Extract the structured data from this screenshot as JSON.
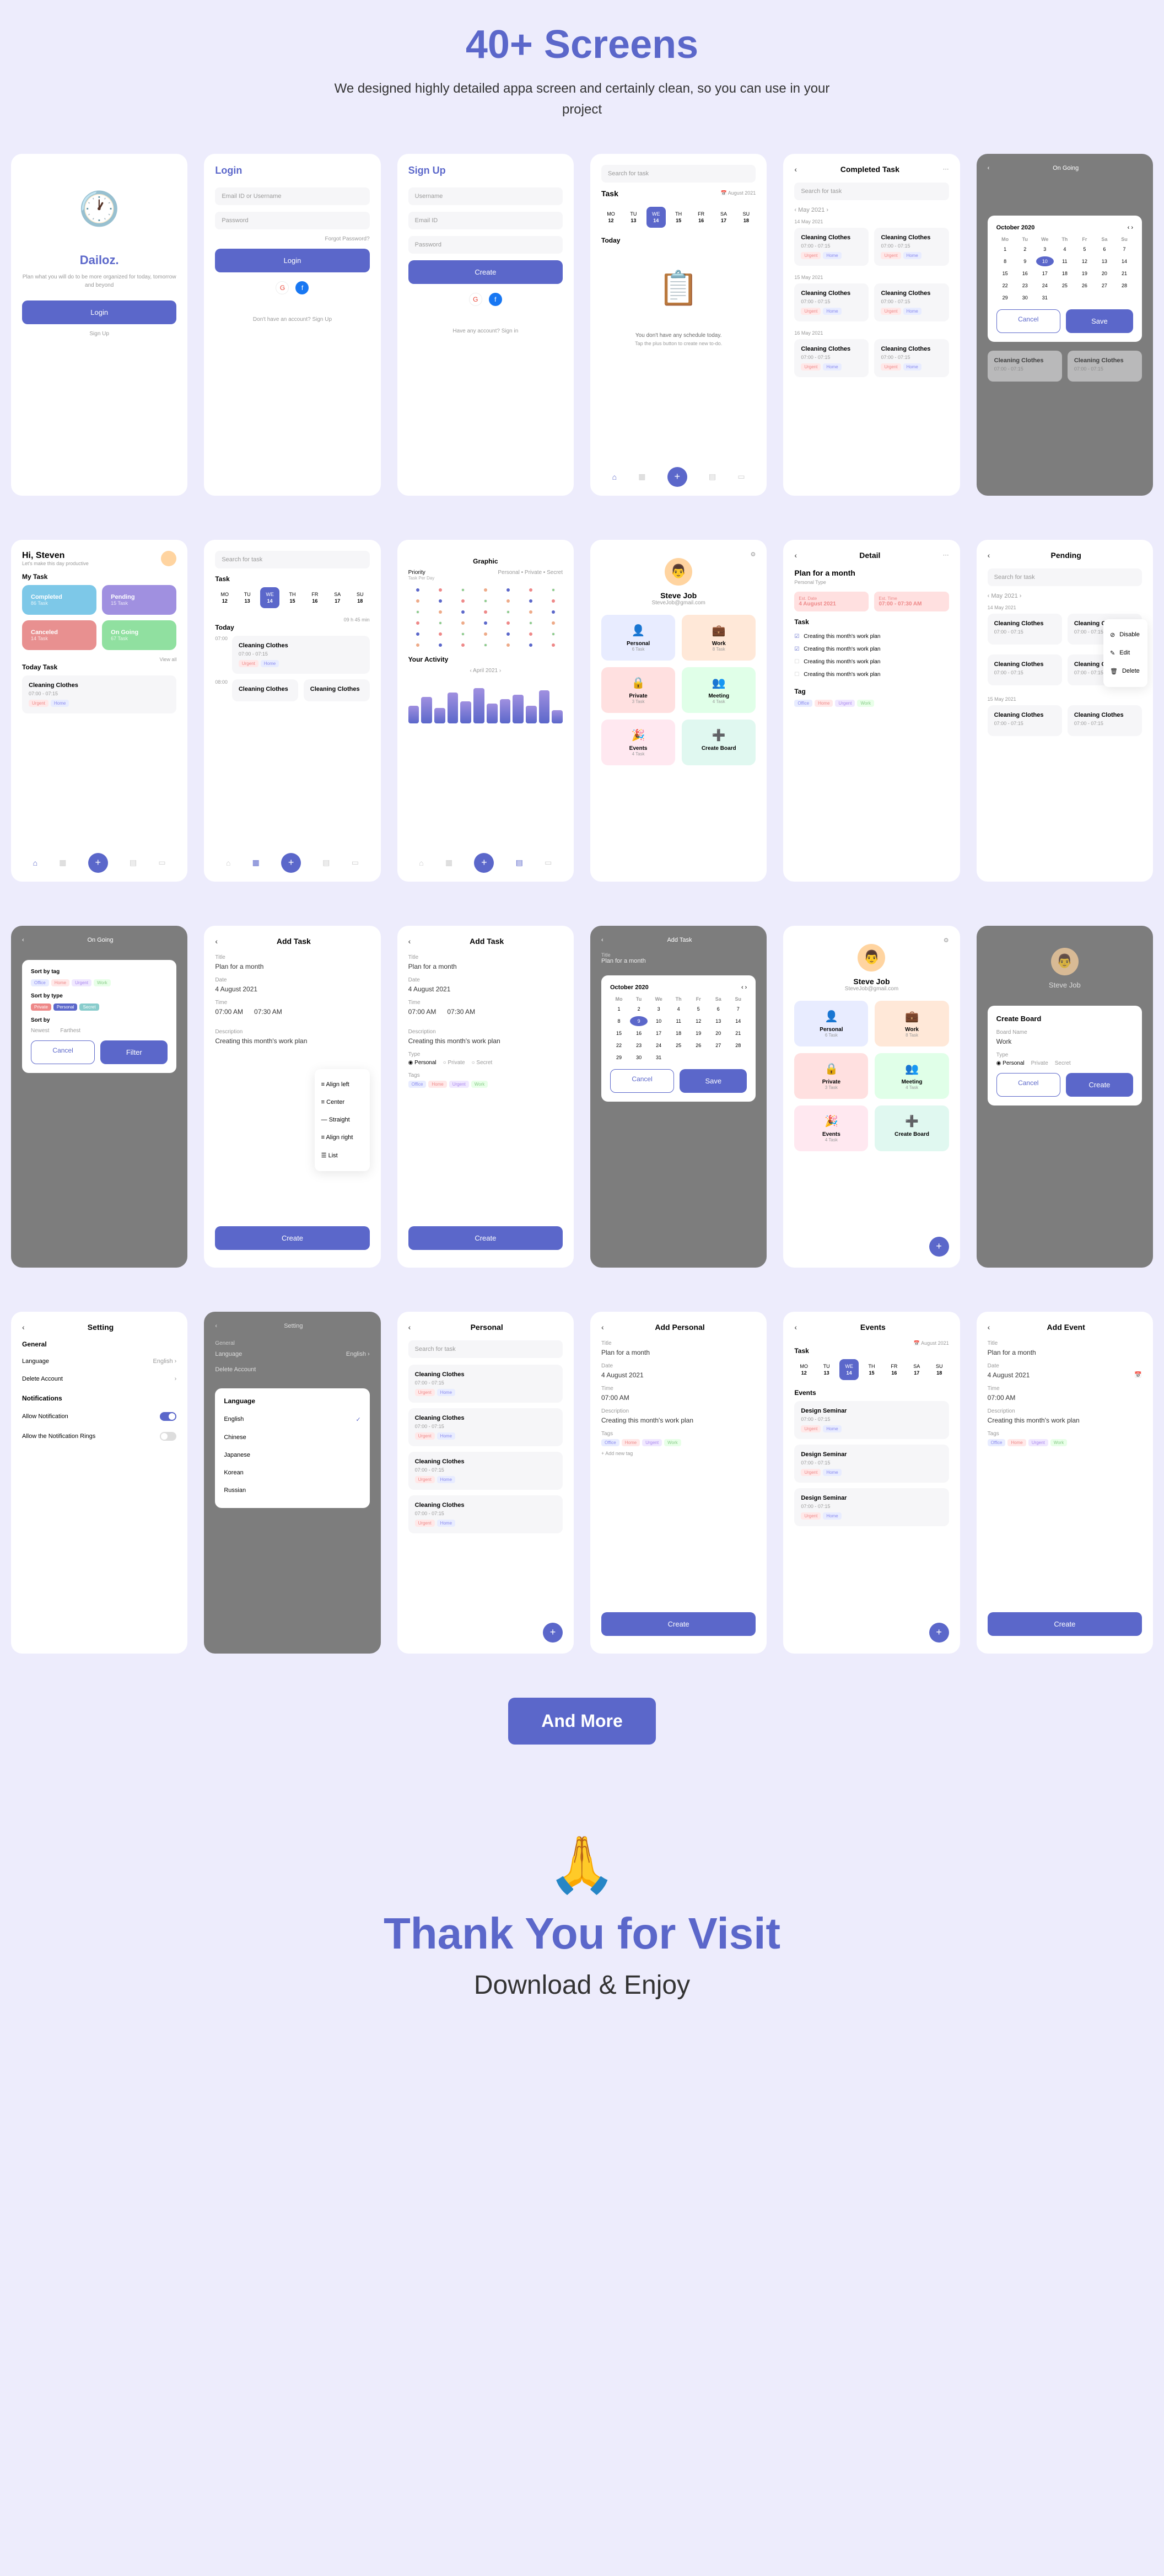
{
  "hero": {
    "title": "40+ Screens",
    "subtitle": "We designed highly detailed appa screen and certainly clean, so you can use in your project"
  },
  "cta": {
    "label": "And More"
  },
  "thanks": {
    "emoji": "🙏",
    "title": "Thank You for Visit",
    "subtitle": "Download & Enjoy"
  },
  "common": {
    "login": "Login",
    "signup": "Sign Up",
    "create": "Create",
    "cancel": "Cancel",
    "save": "Save",
    "filter": "Filter",
    "back": "‹",
    "dots": "⋯",
    "search": "Search for task",
    "forgot": "Forgot Password?",
    "noaccount": "Don't have an account? Sign Up",
    "hasaccount": "Have any account? Sign in",
    "task": "Task",
    "today": "Today",
    "date_aug": "📅 August 2021"
  },
  "welcome": {
    "app": "Dailoz.",
    "tagline": "Plan what you will do to be more organized for today, tomorrow and beyond",
    "signup": "Sign Up"
  },
  "login_fields": {
    "email": "Email ID or Username",
    "password": "Password"
  },
  "signup_fields": {
    "username": "Username",
    "email": "Email ID",
    "password": "Password"
  },
  "days": [
    {
      "d": "MO",
      "n": "12"
    },
    {
      "d": "TU",
      "n": "13"
    },
    {
      "d": "WE",
      "n": "14"
    },
    {
      "d": "TH",
      "n": "15"
    },
    {
      "d": "FR",
      "n": "16"
    },
    {
      "d": "SA",
      "n": "17"
    },
    {
      "d": "SU",
      "n": "18"
    }
  ],
  "empty": {
    "msg": "You don't have any schedule today.",
    "hint": "Tap the plus button to create new to-do."
  },
  "completed": {
    "title": "Completed Task",
    "month": "May 2021",
    "dates": [
      "14 May 2021",
      "15 May 2021",
      "16 May 2021"
    ]
  },
  "card": {
    "title": "Cleaning Clothes",
    "time": "07:00 - 07:15",
    "tags": [
      "Urgent",
      "Home"
    ]
  },
  "ongoing": {
    "title": "On Going",
    "cal_month": "October 2020"
  },
  "home": {
    "greeting": "Hi, Steven",
    "sub": "Let's make this day productive",
    "mytask": "My Task",
    "todaytask": "Today Task",
    "viewall": "View all",
    "stats": [
      {
        "t": "Completed",
        "s": "86 Task"
      },
      {
        "t": "Pending",
        "s": "15 Task"
      },
      {
        "t": "Canceled",
        "s": "14 Task"
      },
      {
        "t": "On Going",
        "s": "67 Task"
      }
    ]
  },
  "task2": {
    "title": "Task",
    "thishour": "09 h 45 min",
    "sub": "Task Per Day"
  },
  "graphic": {
    "title": "Graphic",
    "priority": "Priority",
    "tabs": [
      "Personal",
      "Private",
      "Secret"
    ],
    "activity": "Your Activity",
    "month": "April 2021"
  },
  "profile": {
    "name": "Steve Job",
    "email": "SteveJob@gmail.com",
    "cats": [
      {
        "t": "Personal",
        "s": "6 Task"
      },
      {
        "t": "Work",
        "s": "8 Task"
      },
      {
        "t": "Private",
        "s": "3 Task"
      },
      {
        "t": "Meeting",
        "s": "4 Task"
      },
      {
        "t": "Events",
        "s": "4 Task"
      },
      {
        "t": "Create Board",
        "s": ""
      }
    ]
  },
  "detail": {
    "title": "Detail",
    "plan": "Plan for a month",
    "ptype": "Personal Type",
    "est": "Est. Date",
    "est_val": "4 August 2021",
    "esttime": "Est. Time",
    "esttime_val": "07:00 - 07:30 AM",
    "task": "Task",
    "todos": [
      "Creating this month's work plan",
      "Creating this month's work plan",
      "Creating this month's work plan",
      "Creating this month's work plan"
    ],
    "tag": "Tag"
  },
  "pending": {
    "title": "Pending",
    "month": "May 2021",
    "actions": [
      "Disable",
      "Edit",
      "Delete"
    ]
  },
  "sortmodal": {
    "bytag": "Sort by tag",
    "bytype": "Sort by type",
    "by": "Sort by",
    "newest": "Newest",
    "farthest": "Farthest",
    "tagopts": [
      "Office",
      "Home",
      "Urgent",
      "Work"
    ],
    "typeopts": [
      "Private",
      "Personal",
      "Secret"
    ]
  },
  "addtask": {
    "title": "Add Task",
    "titlelbl": "Title",
    "titleval": "Plan for a month",
    "datelbl": "Date",
    "dateval": "4 August 2021",
    "timelbl": "Time",
    "timefrom": "07:00 AM",
    "timeto": "07:30 AM",
    "desclbl": "Description",
    "descval": "Creating this month's work plan",
    "typelbl": "Type",
    "types": [
      "Personal",
      "Private",
      "Secret"
    ],
    "tagslbl": "Tags",
    "align": [
      "Align left",
      "Center",
      "Straight",
      "Align right",
      "List"
    ]
  },
  "createboard": {
    "title": "Create Board",
    "namelbl": "Board Name",
    "nameval": "Work",
    "typelbl": "Type",
    "types": [
      "Personal",
      "Private",
      "Secret"
    ]
  },
  "setting": {
    "title": "Setting",
    "general": "General",
    "lang": "Language",
    "langval": "English ›",
    "delete": "Delete Account",
    "notif": "Notifications",
    "allow": "Allow Notification",
    "ring": "Allow the Notification Rings",
    "langs": [
      "English",
      "Chinese",
      "Japanese",
      "Korean",
      "Russian"
    ],
    "langpop": "Language"
  },
  "personal": {
    "title": "Personal"
  },
  "addpersonal": {
    "title": "Add Personal",
    "addtag": "+ Add new tag"
  },
  "events": {
    "title": "Events",
    "item": "Design Seminar"
  },
  "addevent": {
    "title": "Add Event"
  },
  "cal": {
    "heads": [
      "Mo",
      "Tu",
      "We",
      "Th",
      "Fr",
      "Sa",
      "Su"
    ]
  }
}
